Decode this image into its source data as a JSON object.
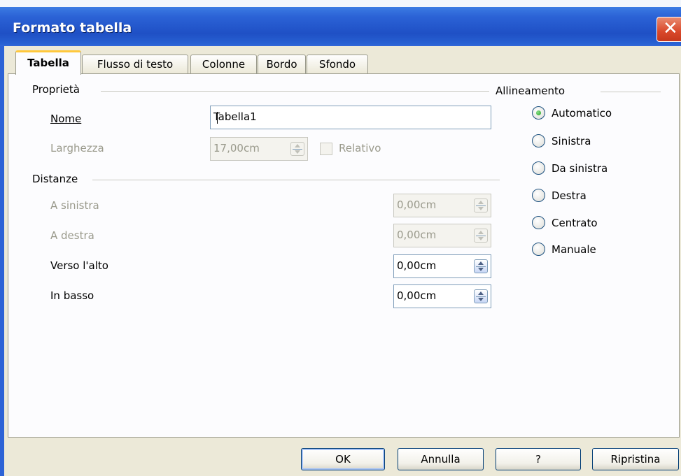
{
  "window": {
    "title": "Formato tabella",
    "close_glyph": "✕"
  },
  "tabs": [
    {
      "label": "Tabella",
      "active": true
    },
    {
      "label": "Flusso di testo",
      "active": false
    },
    {
      "label": "Colonne",
      "active": false
    },
    {
      "label": "Bordo",
      "active": false
    },
    {
      "label": "Sfondo",
      "active": false
    }
  ],
  "properties": {
    "section_label": "Proprietà",
    "name_label": "Nome",
    "name_value": "Tabella1",
    "width_label": "Larghezza",
    "width_value": "17,00cm",
    "relative_label": "Relativo",
    "relative_checked": false
  },
  "spacing": {
    "section_label": "Distanze",
    "rows": [
      {
        "label": "A sinistra",
        "value": "0,00cm",
        "enabled": false
      },
      {
        "label": "A destra",
        "value": "0,00cm",
        "enabled": false
      },
      {
        "label": "Verso l'alto",
        "value": "0,00cm",
        "enabled": true
      },
      {
        "label": "In basso",
        "value": "0,00cm",
        "enabled": true
      }
    ]
  },
  "alignment": {
    "section_label": "Allineamento",
    "options": [
      {
        "label": "Automatico",
        "selected": true
      },
      {
        "label": "Sinistra",
        "selected": false
      },
      {
        "label": "Da sinistra",
        "selected": false
      },
      {
        "label": "Destra",
        "selected": false
      },
      {
        "label": "Centrato",
        "selected": false
      },
      {
        "label": "Manuale",
        "selected": false
      }
    ]
  },
  "buttons": {
    "ok": "OK",
    "cancel": "Annulla",
    "help": "?",
    "reset": "Ripristina"
  },
  "colors": {
    "title_bar": "#2b62d6",
    "dialog_bg": "#ece9d8",
    "panel_bg": "#fcfcfe",
    "active_tab_accent": "#ffc83c",
    "disabled_text": "#9a9a8c"
  }
}
